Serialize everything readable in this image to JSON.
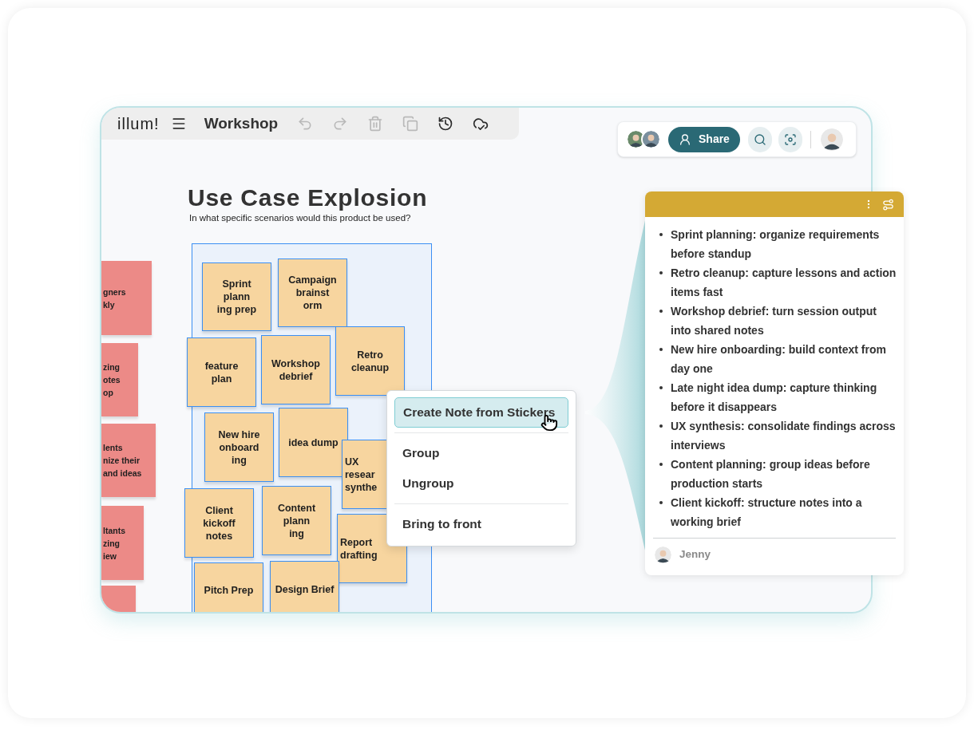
{
  "toolbar": {
    "logo": "illum!",
    "title": "Workshop",
    "tools": [
      {
        "kind": "undo",
        "disabled": true
      },
      {
        "kind": "redo",
        "disabled": true
      },
      {
        "kind": "delete",
        "disabled": true
      },
      {
        "kind": "duplicate",
        "disabled": true
      },
      {
        "kind": "history",
        "disabled": false
      },
      {
        "kind": "saved",
        "disabled": false
      }
    ]
  },
  "top_right": {
    "share_label": "Share"
  },
  "board": {
    "title": "Use Case Explosion",
    "subtitle": "In what specific scenarios would this product be used?",
    "stickers": [
      {
        "color": "#ec8a87",
        "selected": false,
        "lines": [
          "gners",
          "kly"
        ]
      },
      {
        "color": "#ec8a87",
        "selected": false,
        "lines": [
          "zing",
          "otes",
          "op"
        ]
      },
      {
        "color": "#ec8a87",
        "selected": false,
        "lines": [
          "lents",
          "nize their",
          "and ideas"
        ]
      },
      {
        "color": "#ec8a87",
        "selected": false,
        "lines": [
          "ltants",
          "zing",
          "iew"
        ]
      },
      {
        "color": "#ec8a87",
        "selected": false
      },
      {
        "color": "#f7d59f",
        "selected": true,
        "lines": [
          "Sprint",
          "plann",
          "ing prep"
        ]
      },
      {
        "color": "#f7d59f",
        "selected": true,
        "lines": [
          "Campaign",
          "brainst",
          "orm"
        ]
      },
      {
        "color": "#f7d59f",
        "selected": true,
        "lines": [
          "feature",
          "plan"
        ]
      },
      {
        "color": "#f7d59f",
        "selected": true,
        "lines": [
          "Workshop",
          "debrief"
        ]
      },
      {
        "color": "#f7d59f",
        "selected": true,
        "lines": [
          "Retro",
          "cleanup"
        ]
      },
      {
        "color": "#f7d59f",
        "selected": true,
        "lines": [
          "New hire",
          "onboard",
          "ing"
        ]
      },
      {
        "color": "#f7d59f",
        "selected": true,
        "lines": [
          "idea dump"
        ]
      },
      {
        "color": "#f7d59f",
        "selected": true,
        "lines": [
          "UX",
          "resear",
          "synthe"
        ]
      },
      {
        "color": "#f7d59f",
        "selected": true,
        "lines": [
          "Client",
          "kickoff",
          "notes"
        ]
      },
      {
        "color": "#f7d59f",
        "selected": true,
        "lines": [
          "Content",
          "plann",
          "ing"
        ]
      },
      {
        "color": "#f7d59f",
        "selected": true,
        "lines": [
          "Report",
          "drafting"
        ]
      },
      {
        "color": "#f7d59f",
        "selected": true,
        "lines": [
          "Pitch Prep"
        ]
      },
      {
        "color": "#f7d59f",
        "selected": true,
        "lines": [
          "Design Brief"
        ]
      }
    ]
  },
  "context_menu": {
    "items": [
      {
        "label": "Create Note from Stickers",
        "selected": true
      },
      {
        "label": "Group",
        "selected": false
      },
      {
        "label": "Ungroup",
        "selected": false
      },
      {
        "label": "Bring to front",
        "selected": false
      }
    ]
  },
  "note": {
    "items": [
      "Sprint planning: organize requirements before standup",
      "Retro cleanup: capture lessons and action items fast",
      "Workshop debrief: turn session output into shared notes",
      "New hire onboarding: build context from day one",
      "Late night idea dump: capture thinking before it disappears",
      "UX synthesis: consolidate findings across interviews",
      "Content planning: group ideas before production starts",
      "Client kickoff: structure notes into a working brief"
    ],
    "author": "Jenny"
  }
}
